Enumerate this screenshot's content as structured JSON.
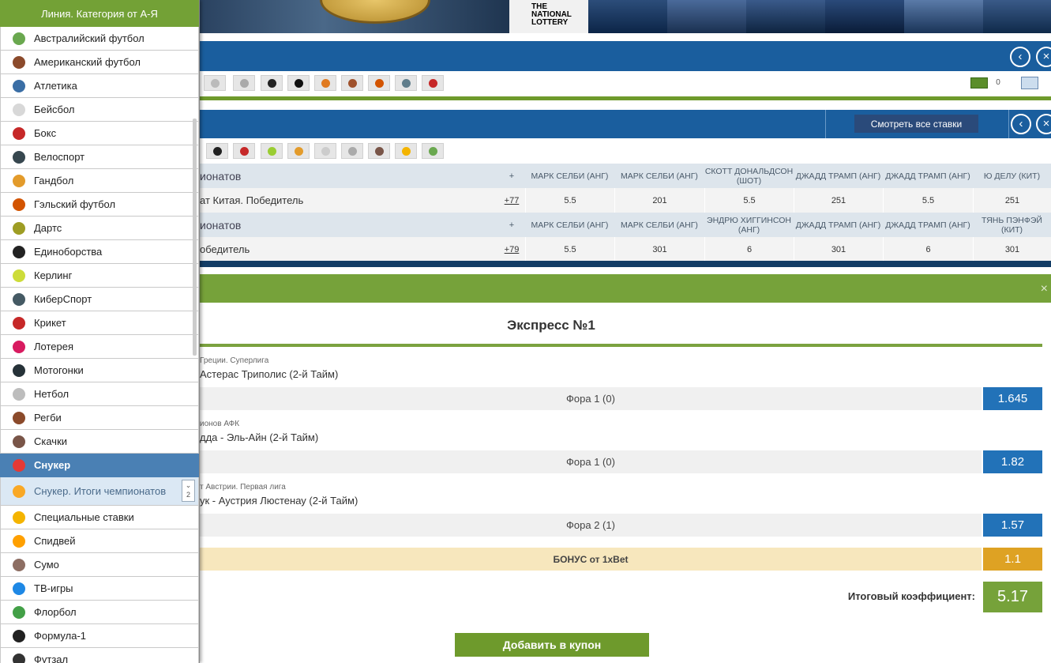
{
  "sidebar": {
    "header": "Линия. Категория от А-Я",
    "items": [
      {
        "label": "Австралийский футбол",
        "icon": "australian-football-icon",
        "color": "#6aa84f"
      },
      {
        "label": "Американский футбол",
        "icon": "american-football-icon",
        "color": "#8b4a2b"
      },
      {
        "label": "Атлетика",
        "icon": "athletics-shoe-icon",
        "color": "#3a6ea5"
      },
      {
        "label": "Бейсбол",
        "icon": "baseball-icon",
        "color": "#d8d8d8"
      },
      {
        "label": "Бокс",
        "icon": "boxing-glove-icon",
        "color": "#c62828"
      },
      {
        "label": "Велоспорт",
        "icon": "cycling-helmet-icon",
        "color": "#37474f"
      },
      {
        "label": "Гандбол",
        "icon": "handball-icon",
        "color": "#e39b2b"
      },
      {
        "label": "Гэльский футбол",
        "icon": "gaelic-football-icon",
        "color": "#d35400"
      },
      {
        "label": "Дартс",
        "icon": "darts-icon",
        "color": "#9e9d24"
      },
      {
        "label": "Единоборства",
        "icon": "yin-yang-icon",
        "color": "#222222"
      },
      {
        "label": "Керлинг",
        "icon": "curling-stone-icon",
        "color": "#cddc39"
      },
      {
        "label": "КиберСпорт",
        "icon": "gamepad-icon",
        "color": "#455a64"
      },
      {
        "label": "Крикет",
        "icon": "cricket-icon",
        "color": "#c62828"
      },
      {
        "label": "Лотерея",
        "icon": "lottery-ticket-icon",
        "color": "#d81b60"
      },
      {
        "label": "Мотогонки",
        "icon": "moto-helmet-icon",
        "color": "#263238"
      },
      {
        "label": "Нетбол",
        "icon": "netball-hoop-icon",
        "color": "#bdbdbd"
      },
      {
        "label": "Регби",
        "icon": "rugby-ball-icon",
        "color": "#8b4a2b"
      },
      {
        "label": "Скачки",
        "icon": "horse-racing-icon",
        "color": "#795548"
      },
      {
        "label": "Снукер",
        "icon": "snooker-triangle-icon",
        "color": "#e53935",
        "active": true
      },
      {
        "label": "Снукер. Итоги чемпионатов",
        "icon": "trophy-icon",
        "color": "#f9a825",
        "sub": true,
        "badge": "2"
      },
      {
        "label": "Специальные ставки",
        "icon": "star-badge-icon",
        "color": "#f4b400"
      },
      {
        "label": "Спидвей",
        "icon": "speedway-helmet-icon",
        "color": "#ffa000"
      },
      {
        "label": "Сумо",
        "icon": "sumo-icon",
        "color": "#8d6e63"
      },
      {
        "label": "ТВ-игры",
        "icon": "tv-icon",
        "color": "#1e88e5"
      },
      {
        "label": "Флорбол",
        "icon": "floorball-icon",
        "color": "#43a047"
      },
      {
        "label": "Формула-1",
        "icon": "wheel-icon",
        "color": "#212121"
      },
      {
        "label": "Футзал",
        "icon": "futsal-ball-icon",
        "color": "#333333"
      }
    ]
  },
  "banner": {
    "lottery_text": "THE NATIONAL LOTTERY"
  },
  "section1": {
    "counter": "0"
  },
  "section2": {
    "view_all_button": "Смотреть все ставки"
  },
  "table": {
    "rows": [
      {
        "type": "head",
        "title": "ионатов",
        "plus": "+",
        "cols": [
          "МАРК СЕЛБИ (АНГ)",
          "МАРК СЕЛБИ (АНГ)",
          "СКОТТ ДОНАЛЬДСОН (ШОТ)",
          "ДЖАДД ТРАМП (АНГ)",
          "ДЖАДД ТРАМП (АНГ)",
          "Ю ДЕЛУ (КИТ)"
        ]
      },
      {
        "type": "data",
        "title": "ат Китая. Победитель",
        "plus": "+77",
        "cols": [
          "5.5",
          "201",
          "5.5",
          "251",
          "5.5",
          "251"
        ]
      },
      {
        "type": "head",
        "title": "ионатов",
        "plus": "+",
        "cols": [
          "МАРК СЕЛБИ (АНГ)",
          "МАРК СЕЛБИ (АНГ)",
          "ЭНДРЮ ХИГГИНСОН (АНГ)",
          "ДЖАДД ТРАМП (АНГ)",
          "ДЖАДД ТРАМП (АНГ)",
          "ТЯНЬ ПЭНФЭЙ (КИТ)"
        ]
      },
      {
        "type": "data",
        "title": "обедитель",
        "plus": "+79",
        "cols": [
          "5.5",
          "301",
          "6",
          "301",
          "6",
          "301"
        ]
      }
    ]
  },
  "express": {
    "close": "×",
    "title": "Экспресс №1",
    "events": [
      {
        "league": "Греции. Суперлига",
        "name": "Астерас Триполис (2-й Тайм)",
        "bet": "Фора 1 (0)",
        "odd": "1.645"
      },
      {
        "league": "ионов АФК",
        "name": "дда - Эль-Айн (2-й Тайм)",
        "bet": "Фора 1 (0)",
        "odd": "1.82"
      },
      {
        "league": "т Австрии. Первая лига",
        "name": "ук - Аустрия Люстенау (2-й Тайм)",
        "bet": "Фора 2 (1)",
        "odd": "1.57"
      }
    ],
    "bonus_label": "БОНУС от 1xBet",
    "bonus_odd": "1.1",
    "total_label": "Итоговый коэффициент:",
    "total_value": "5.17",
    "add_button": "Добавить в купон"
  },
  "colors": {
    "accent_green": "#76a23a",
    "primary_blue": "#1a5e9e",
    "odd_blue": "#2272b8",
    "bonus_gold": "#dea223"
  }
}
